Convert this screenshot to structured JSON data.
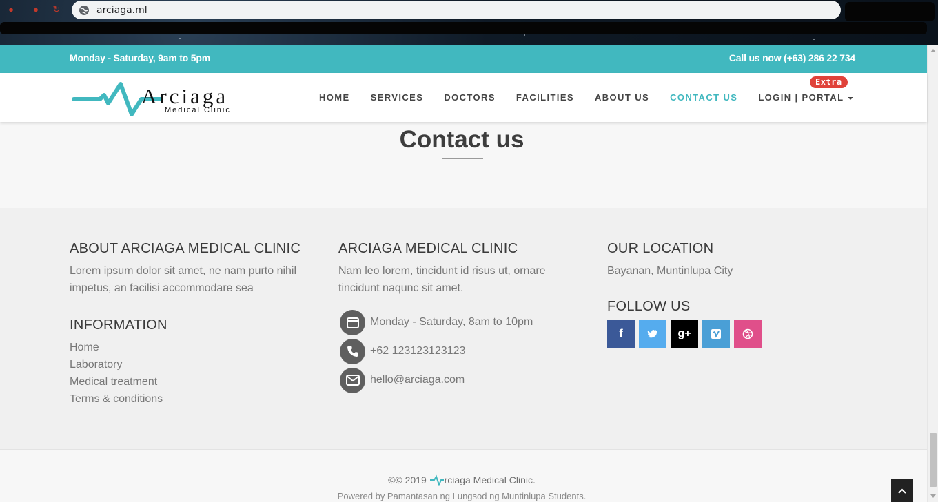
{
  "browser": {
    "url": "arciaga.ml"
  },
  "topbar": {
    "hours": "Monday - Saturday, 9am to 5pm",
    "phone": "Call us now (+63) 286 22 734"
  },
  "logo": {
    "wordmark": "Arciaga",
    "subtitle": "Medical Clinic"
  },
  "nav": {
    "items": [
      {
        "label": "HOME"
      },
      {
        "label": "SERVICES"
      },
      {
        "label": "DOCTORS"
      },
      {
        "label": "FACILITIES"
      },
      {
        "label": "ABOUT US"
      },
      {
        "label": "CONTACT US",
        "active": true
      },
      {
        "label": "LOGIN | PORTAL"
      }
    ],
    "badge": "Extra"
  },
  "page": {
    "title": "Contact us"
  },
  "footer": {
    "about": {
      "heading": "ABOUT ARCIAGA MEDICAL CLINIC",
      "text": "Lorem ipsum dolor sit amet, ne nam purto nihil impetus, an facilisi accommodare sea"
    },
    "information": {
      "heading": "INFORMATION",
      "links": [
        "Home",
        "Laboratory",
        "Medical treatment",
        "Terms & conditions"
      ]
    },
    "clinic": {
      "heading": "ARCIAGA MEDICAL CLINIC",
      "text": "Nam leo lorem, tincidunt id risus ut, ornare tincidunt naqunc sit amet.",
      "schedule": "Monday - Saturday, 8am to 10pm",
      "phone": "+62 123123123123",
      "email": "hello@arciaga.com"
    },
    "location": {
      "heading": "OUR LOCATION",
      "text": "Bayanan, Muntinlupa City"
    },
    "follow": {
      "heading": "FOLLOW US",
      "networks": [
        {
          "name": "facebook",
          "glyph": "f",
          "color": "#3b5998"
        },
        {
          "name": "twitter",
          "glyph": "t",
          "color": "#55acee"
        },
        {
          "name": "google-plus",
          "glyph": "g+",
          "color": "#000000"
        },
        {
          "name": "vimeo",
          "glyph": "v",
          "color": "#4a9fd6"
        },
        {
          "name": "dribbble",
          "glyph": "d",
          "color": "#e04f8a"
        }
      ]
    }
  },
  "bottom": {
    "copyright_prefix": "©© 2019",
    "copyright_suffix": "rciaga Medical Clinic.",
    "powered": "Powered by Pamantasan ng Lungsod ng Muntinlupa Students."
  },
  "colors": {
    "accent": "#41b8bf",
    "badge": "#e0423a"
  }
}
